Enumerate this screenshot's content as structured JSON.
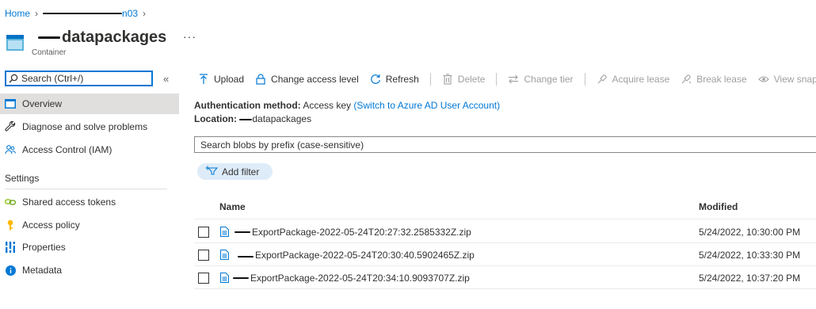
{
  "breadcrumb": {
    "home": "Home",
    "item": "n03"
  },
  "header": {
    "title": "datapackages",
    "subtitle": "Container",
    "more": "···"
  },
  "sidebar": {
    "search_placeholder": "Search (Ctrl+/)",
    "collapse": "«",
    "items": [
      {
        "label": "Overview"
      },
      {
        "label": "Diagnose and solve problems"
      },
      {
        "label": "Access Control (IAM)"
      }
    ],
    "settings_title": "Settings",
    "settings_items": [
      {
        "label": "Shared access tokens"
      },
      {
        "label": "Access policy"
      },
      {
        "label": "Properties"
      },
      {
        "label": "Metadata"
      }
    ]
  },
  "toolbar": {
    "upload": "Upload",
    "change_access": "Change access level",
    "refresh": "Refresh",
    "delete": "Delete",
    "change_tier": "Change tier",
    "acquire_lease": "Acquire lease",
    "break_lease": "Break lease",
    "view_snapshots": "View snapsh"
  },
  "info": {
    "auth_label": "Authentication method:",
    "auth_value": "Access key",
    "auth_link": "(Switch to Azure AD User Account)",
    "location_label": "Location:",
    "location_value": "datapackages"
  },
  "blob_search": {
    "placeholder": "Search blobs by prefix (case-sensitive)"
  },
  "filter": {
    "label": "Add filter"
  },
  "table": {
    "headers": {
      "name": "Name",
      "modified": "Modified"
    },
    "rows": [
      {
        "name": "ExportPackage-2022-05-24T20:27:32.2585332Z.zip",
        "modified": "5/24/2022, 10:30:00 PM"
      },
      {
        "name": "ExportPackage-2022-05-24T20:30:40.5902465Z.zip",
        "modified": "5/24/2022, 10:33:30 PM"
      },
      {
        "name": "ExportPackage-2022-05-24T20:34:10.9093707Z.zip",
        "modified": "5/24/2022, 10:37:20 PM"
      }
    ]
  }
}
